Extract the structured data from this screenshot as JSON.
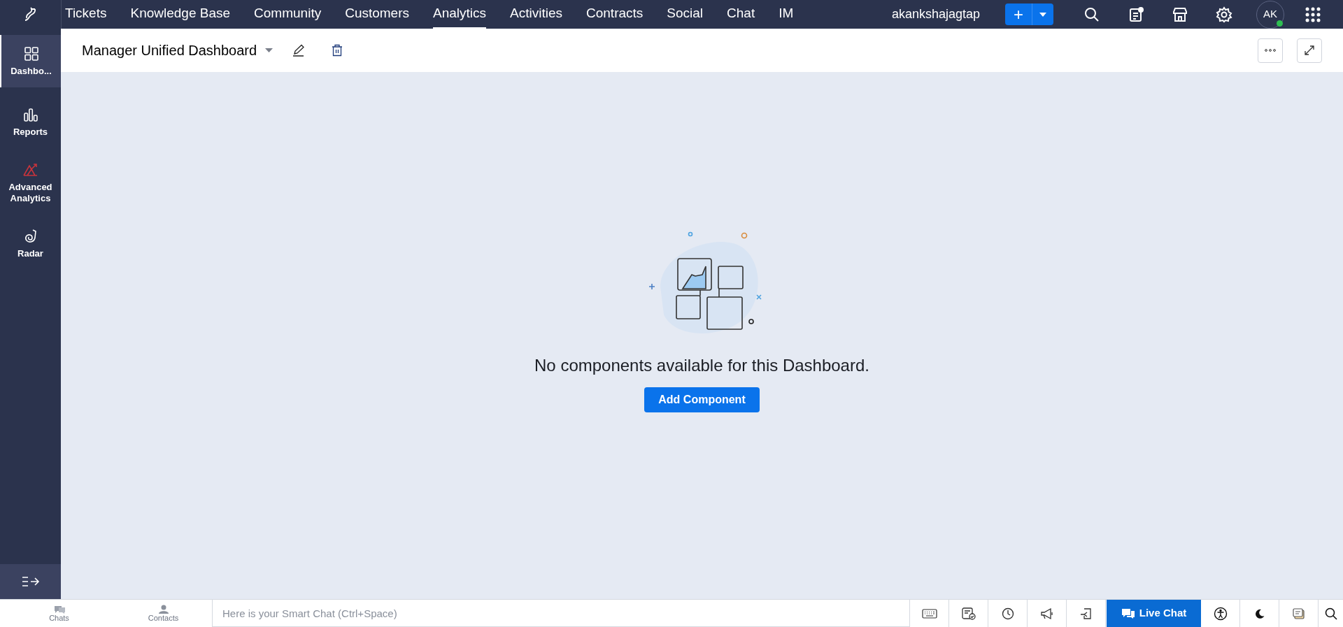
{
  "top_nav": {
    "tabs": [
      {
        "label": "Tickets",
        "selected": false
      },
      {
        "label": "Knowledge Base",
        "selected": false
      },
      {
        "label": "Community",
        "selected": false
      },
      {
        "label": "Customers",
        "selected": false
      },
      {
        "label": "Analytics",
        "selected": true
      },
      {
        "label": "Activities",
        "selected": false
      },
      {
        "label": "Contracts",
        "selected": false
      },
      {
        "label": "Social",
        "selected": false
      },
      {
        "label": "Chat",
        "selected": false
      },
      {
        "label": "IM",
        "selected": false
      }
    ],
    "username": "akankshajagtap",
    "plus_label": "+",
    "avatar_initials": "AK"
  },
  "sidebar": {
    "items": [
      {
        "kind": "grid",
        "label": "Dashbo...",
        "selected": true
      },
      {
        "kind": "bars",
        "label": "Reports",
        "selected": false
      },
      {
        "kind": "advanced",
        "label": "Advanced Analytics",
        "selected": false
      },
      {
        "kind": "radar",
        "label": "Radar",
        "selected": false
      }
    ]
  },
  "header": {
    "title": "Manager Unified Dashboard"
  },
  "empty_state": {
    "message": "No components available for this Dashboard.",
    "button": "Add Component"
  },
  "bottom_bar": {
    "tabs": [
      "Chats",
      "Contacts"
    ],
    "placeholder": "Here is your Smart Chat (Ctrl+Space)",
    "live_chat": "Live Chat"
  }
}
